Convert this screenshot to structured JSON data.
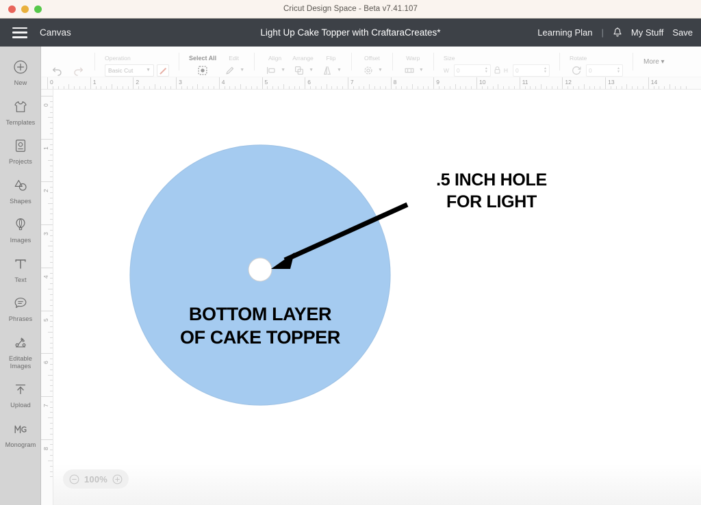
{
  "window": {
    "title": "Cricut Design Space - Beta v7.41.107",
    "traffic_lights": [
      "close-red",
      "minimize-yellow",
      "maximize-green"
    ]
  },
  "header": {
    "menu_icon": "hamburger-icon",
    "canvas_label": "Canvas",
    "document_title": "Light Up Cake Topper with CraftaraCreates*",
    "learning_plan": "Learning Plan",
    "separator": "|",
    "bell_icon": "bell-icon",
    "my_stuff": "My Stuff",
    "save": "Save"
  },
  "sidebar": {
    "items": [
      {
        "label": "New",
        "icon": "plus-circle-icon"
      },
      {
        "label": "Templates",
        "icon": "tshirt-icon"
      },
      {
        "label": "Projects",
        "icon": "project-card-icon"
      },
      {
        "label": "Shapes",
        "icon": "shapes-icon"
      },
      {
        "label": "Images",
        "icon": "hot-air-balloon-icon"
      },
      {
        "label": "Text",
        "icon": "text-t-icon"
      },
      {
        "label": "Phrases",
        "icon": "speech-bubble-icon"
      },
      {
        "label": "Editable Images",
        "icon": "editable-images-icon"
      },
      {
        "label": "Upload",
        "icon": "upload-arrow-icon"
      },
      {
        "label": "Monogram",
        "icon": "monogram-icon"
      }
    ]
  },
  "toolbar": {
    "undo": "undo-icon",
    "redo": "redo-icon",
    "operation_caption": "Operation",
    "operation_value": "Basic Cut",
    "color_swatch": "line-color-swatch",
    "select_all_caption": "Select All",
    "select_all_icon": "marquee-select-icon",
    "edit_caption": "Edit",
    "edit_icon": "pencil-icon",
    "align_caption": "Align",
    "align_icon": "align-left-icon",
    "arrange_caption": "Arrange",
    "arrange_icon": "layers-icon",
    "flip_caption": "Flip",
    "flip_icon": "flip-horizontal-icon",
    "offset_caption": "Offset",
    "offset_icon": "offset-gear-icon",
    "warp_caption": "Warp",
    "warp_icon": "warp-icon",
    "size_caption": "Size",
    "lock_icon": "lock-icon",
    "width_label": "W",
    "width_value": "0",
    "height_label": "H",
    "height_value": "0",
    "rotate_caption": "Rotate",
    "rotate_icon": "rotate-icon",
    "rotate_value": "0",
    "more_label": "More"
  },
  "rulers": {
    "horizontal_ticks": [
      "0",
      "1",
      "2",
      "3",
      "4",
      "5",
      "6",
      "7",
      "8",
      "9",
      "10",
      "11",
      "12",
      "13",
      "14"
    ],
    "vertical_ticks": [
      "0",
      "1",
      "2",
      "3",
      "4",
      "5",
      "6",
      "7",
      "8"
    ]
  },
  "artboard": {
    "shape_name": "bottom-layer-circle",
    "shape_fill": "#a5cbf0",
    "shape_stroke": "#9fc3e6",
    "hole_name": "light-hole-circle",
    "hole_fill": "#ffffff",
    "label_main_line1": "BOTTOM LAYER",
    "label_main_line2": "OF CAKE TOPPER",
    "callout_line1": ".5 INCH HOLE",
    "callout_line2": "FOR LIGHT",
    "callout_arrow": "arrow-pointing-to-hole",
    "text_color": "#000000"
  },
  "zoom_control": {
    "minus": "minus-circle-icon",
    "value": "100%",
    "plus": "plus-circle-icon"
  }
}
